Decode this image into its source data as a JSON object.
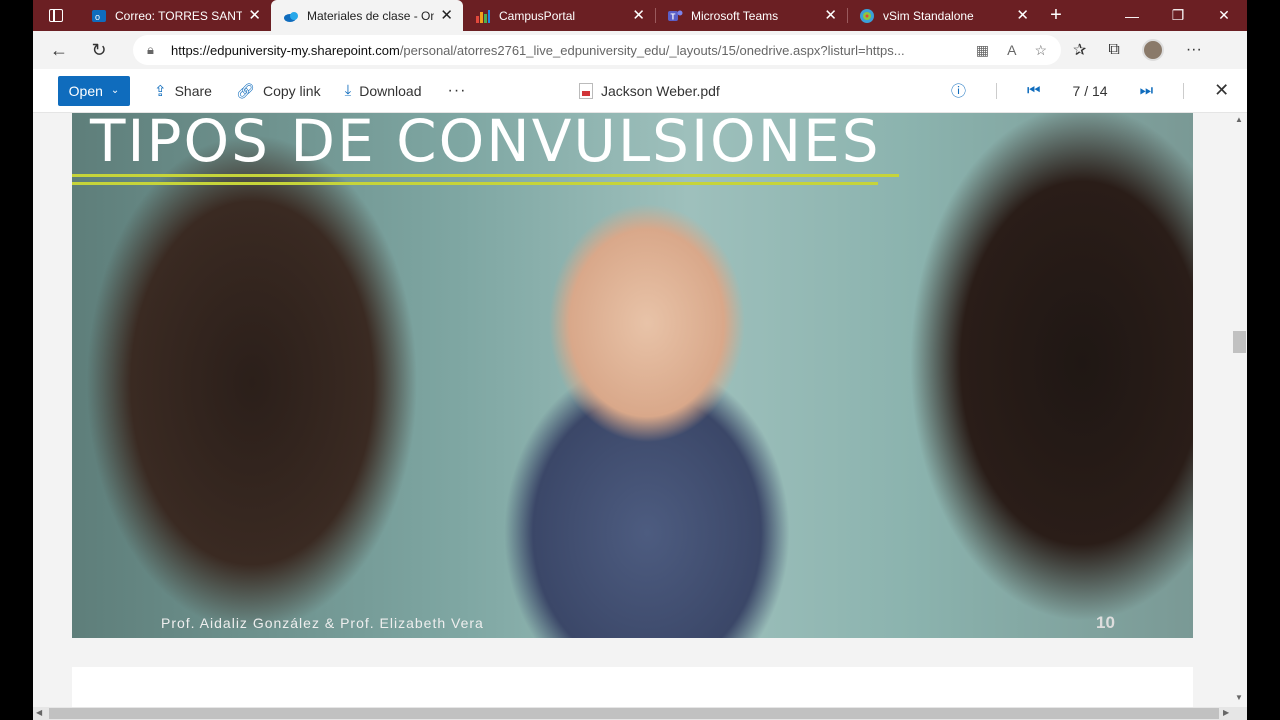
{
  "tabs": [
    {
      "title": "Correo: TORRES SANTANA",
      "icon": "outlook-icon",
      "color": "#0f6cbd"
    },
    {
      "title": "Materiales de clase - OneDrive",
      "icon": "onedrive-icon",
      "color": "#0f6cbd"
    },
    {
      "title": "CampusPortal",
      "icon": "bar-chart-icon",
      "color": "#f2a01a"
    },
    {
      "title": "Microsoft Teams",
      "icon": "teams-icon",
      "color": "#5b5fc7"
    },
    {
      "title": "vSim Standalone",
      "icon": "vsim-icon",
      "color": "#3aa0d8"
    }
  ],
  "address": {
    "host": "https://edpuniversity-my.sharepoint.com",
    "path": "/personal/atorres2761_live_edpuniversity_edu/_layouts/15/onedrive.aspx?listurl=https..."
  },
  "viewer": {
    "open_label": "Open",
    "share_label": "Share",
    "copy_link_label": "Copy link",
    "download_label": "Download",
    "more_label": "···",
    "doc_name": "Jackson Weber.pdf",
    "page_indicator": "7 / 14"
  },
  "slide": {
    "title": "TIPOS DE CONVULSIONES",
    "authors": "Prof. Aidaliz González  &  Prof. Elizabeth Vera",
    "number": "10"
  },
  "colors": {
    "tabstrip": "#6b1f23",
    "accent": "#0f6cbd",
    "title_underline": "#c6d43a"
  }
}
